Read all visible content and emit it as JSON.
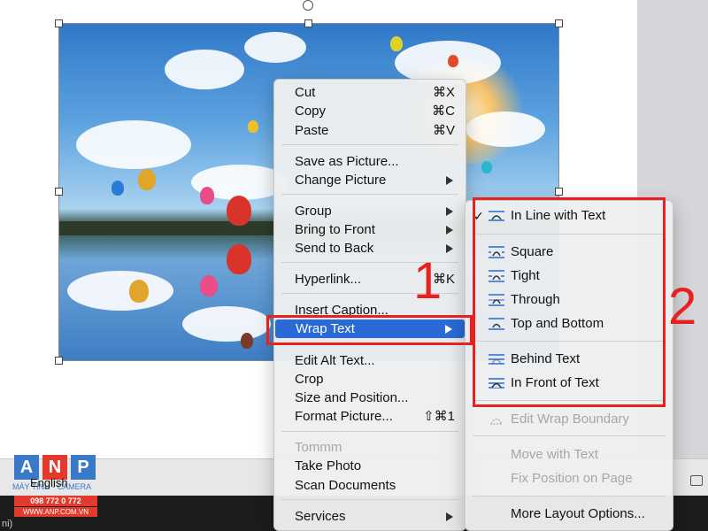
{
  "context_menu": {
    "items": [
      {
        "label": "Cut",
        "shortcut": "⌘X"
      },
      {
        "label": "Copy",
        "shortcut": "⌘C"
      },
      {
        "label": "Paste",
        "shortcut": "⌘V"
      },
      {
        "label": "Save as Picture..."
      },
      {
        "label": "Change Picture"
      },
      {
        "label": "Group"
      },
      {
        "label": "Bring to Front"
      },
      {
        "label": "Send to Back"
      },
      {
        "label": "Hyperlink...",
        "shortcut": "⌘K"
      },
      {
        "label": "Insert Caption..."
      },
      {
        "label": "Wrap Text"
      },
      {
        "label": "Edit Alt Text..."
      },
      {
        "label": "Crop"
      },
      {
        "label": "Size and Position..."
      },
      {
        "label": "Format Picture...",
        "shortcut": "⇧⌘1"
      },
      {
        "label": "Tommm"
      },
      {
        "label": "Take Photo"
      },
      {
        "label": "Scan Documents"
      },
      {
        "label": "Services"
      }
    ]
  },
  "wrap_submenu": {
    "items": [
      {
        "label": "In Line with Text",
        "checked": "✓",
        "icon": "wrap-inline-icon"
      },
      {
        "label": "Square",
        "icon": "wrap-square-icon"
      },
      {
        "label": "Tight",
        "icon": "wrap-tight-icon"
      },
      {
        "label": "Through",
        "icon": "wrap-through-icon"
      },
      {
        "label": "Top and Bottom",
        "icon": "wrap-top-bottom-icon"
      },
      {
        "label": "Behind Text",
        "icon": "wrap-behind-icon"
      },
      {
        "label": "In Front of Text",
        "icon": "wrap-front-icon"
      },
      {
        "label": "Edit Wrap Boundary",
        "icon": "edit-wrap-boundary-icon"
      },
      {
        "label": "Move with Text"
      },
      {
        "label": "Fix Position on Page"
      },
      {
        "label": "More Layout Options..."
      }
    ]
  },
  "annotations": {
    "step1": "1",
    "step2": "2"
  },
  "status": {
    "language": "English",
    "bottom_text": "ni)"
  },
  "logo": {
    "letters": [
      "A",
      "N",
      "P"
    ],
    "tagline": "MÁY TÍNH - CAMERA",
    "phone": "098 772 0 772",
    "website": "WWW.ANP.COM.VN"
  },
  "colors": {
    "highlight": "#2a6ad6",
    "annotation": "#e8201e",
    "logo_blue": "#3a78c8",
    "logo_red": "#e23a2c"
  }
}
